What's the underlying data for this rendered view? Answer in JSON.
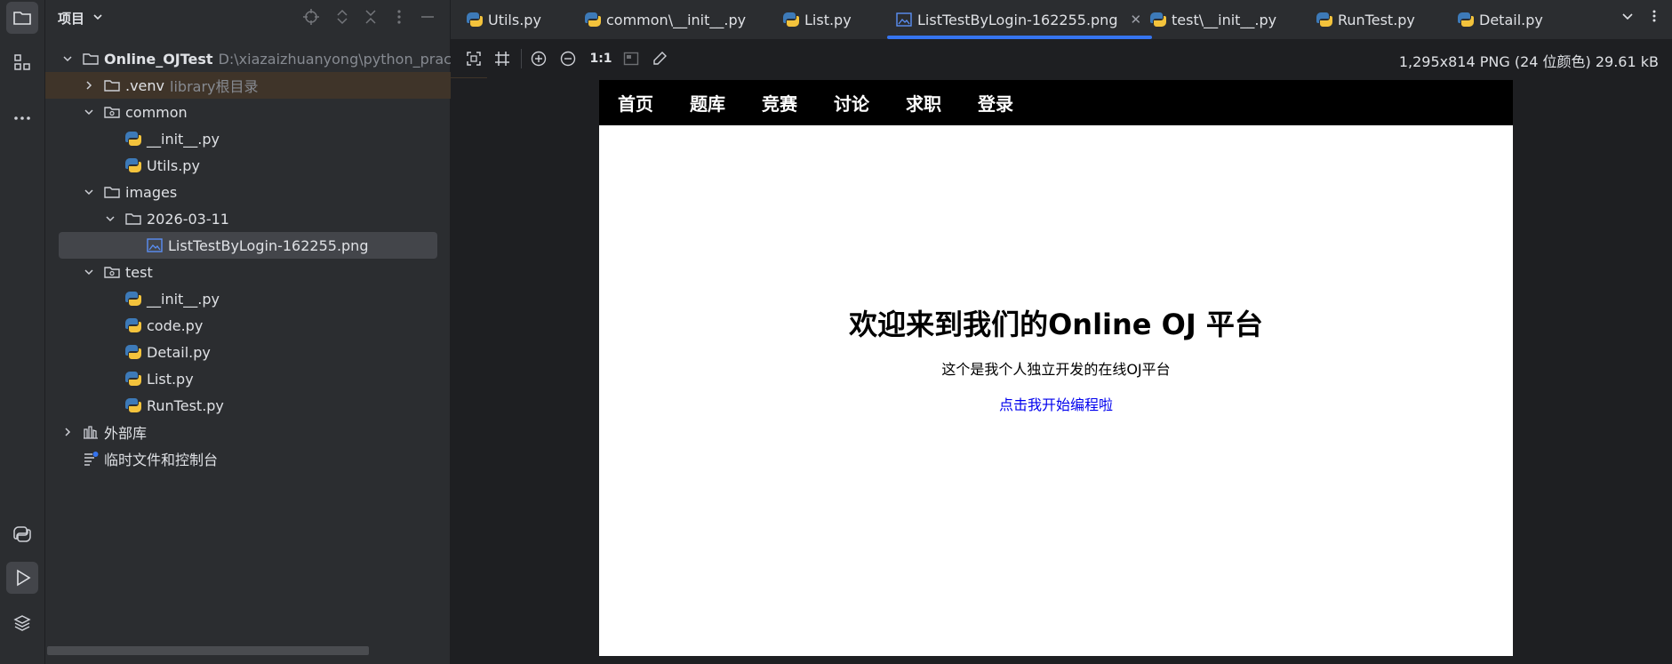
{
  "project_panel": {
    "title": "项目",
    "tree": [
      {
        "label": "Online_OJTest",
        "note": "D:\\xiazaizhuanyong\\python_practise\\C",
        "kind": "root",
        "expanded": true
      },
      {
        "label": ".venv",
        "note": "library根目录",
        "kind": "folder",
        "expanded": false
      },
      {
        "label": "common",
        "kind": "package",
        "expanded": true
      },
      {
        "label": "__init__.py",
        "kind": "python"
      },
      {
        "label": "Utils.py",
        "kind": "python"
      },
      {
        "label": "images",
        "kind": "folder",
        "expanded": true
      },
      {
        "label": "2026-03-11",
        "kind": "folder",
        "expanded": true
      },
      {
        "label": "ListTestByLogin-162255.png",
        "kind": "image",
        "selected": true
      },
      {
        "label": "test",
        "kind": "package",
        "expanded": true
      },
      {
        "label": "__init__.py",
        "kind": "python"
      },
      {
        "label": "code.py",
        "kind": "python"
      },
      {
        "label": "Detail.py",
        "kind": "python"
      },
      {
        "label": "List.py",
        "kind": "python"
      },
      {
        "label": "RunTest.py",
        "kind": "python"
      },
      {
        "label": "外部库",
        "kind": "library",
        "expanded": false
      },
      {
        "label": "临时文件和控制台",
        "kind": "scratch"
      }
    ]
  },
  "tabs": [
    {
      "label": "Utils.py",
      "icon": "python-icon"
    },
    {
      "label": "common\\__init__.py",
      "icon": "python-icon"
    },
    {
      "label": "List.py",
      "icon": "python-icon"
    },
    {
      "label": "ListTestByLogin-162255.png",
      "icon": "image-icon",
      "active": true
    },
    {
      "label": "test\\__init__.py",
      "icon": "python-icon"
    },
    {
      "label": "RunTest.py",
      "icon": "python-icon"
    },
    {
      "label": "Detail.py",
      "icon": "python-icon"
    }
  ],
  "viewer": {
    "zoom_label": "1:1",
    "image_info": "1,295x814 PNG (24 位颜色) 29.61 kB"
  },
  "preview": {
    "nav": [
      "首页",
      "题库",
      "竞赛",
      "讨论",
      "求职",
      "登录"
    ],
    "title": "欢迎来到我们的Online OJ 平台",
    "subtitle": "这个是我个人独立开发的在线OJ平台",
    "link": "点击我开始编程啦"
  },
  "colors": {
    "accent": "#3574f0",
    "link": "#0000ee",
    "panel": "#2b2d30",
    "editor": "#1e1f22"
  }
}
